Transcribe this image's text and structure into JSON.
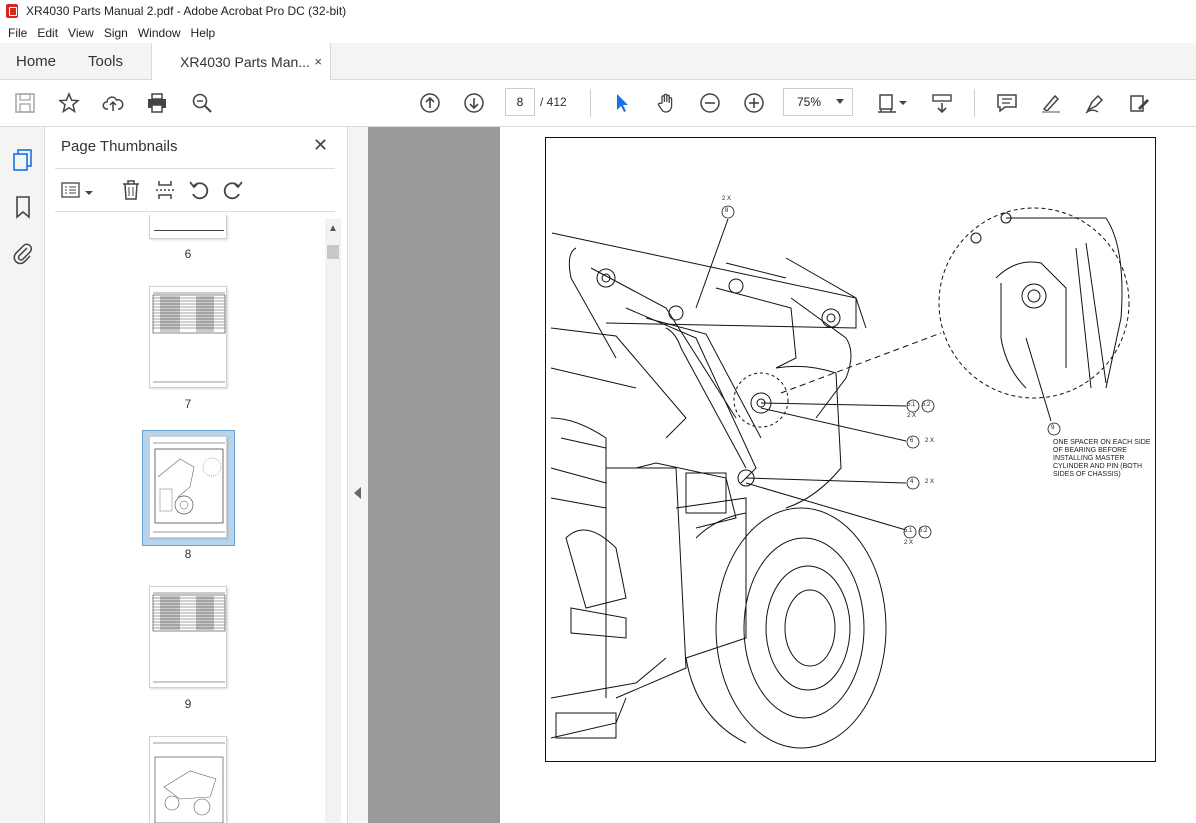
{
  "window": {
    "title": "XR4030 Parts Manual 2.pdf - Adobe Acrobat Pro DC (32-bit)"
  },
  "menu": [
    "File",
    "Edit",
    "View",
    "Sign",
    "Window",
    "Help"
  ],
  "tabs": {
    "home": "Home",
    "tools": "Tools",
    "document": "XR4030 Parts Man...",
    "close": "×"
  },
  "toolbar": {
    "page_current": "8",
    "page_total": "/ 412",
    "zoom": "75%"
  },
  "thumbnails": {
    "title": "Page Thumbnails",
    "close": "✕",
    "pages": [
      "6",
      "7",
      "8",
      "9"
    ]
  },
  "drawing": {
    "callouts": {
      "c8_top_mult": "2 X",
      "c8_top": "8",
      "c51a": "5.1",
      "c52a": "5.2",
      "c5a_mult": "2 X",
      "c6": "6",
      "c6_mult": "2 X",
      "c4": "4",
      "c4_mult": "2 X",
      "c51b": "5.1",
      "c52b": "5.2",
      "c5b_mult": "2 X",
      "c9": "9"
    },
    "note": "ONE SPACER ON EACH SIDE OF BEARING BEFORE INSTALLING MASTER CYLINDER AND PIN (BOTH SIDES OF CHASSIS)"
  }
}
